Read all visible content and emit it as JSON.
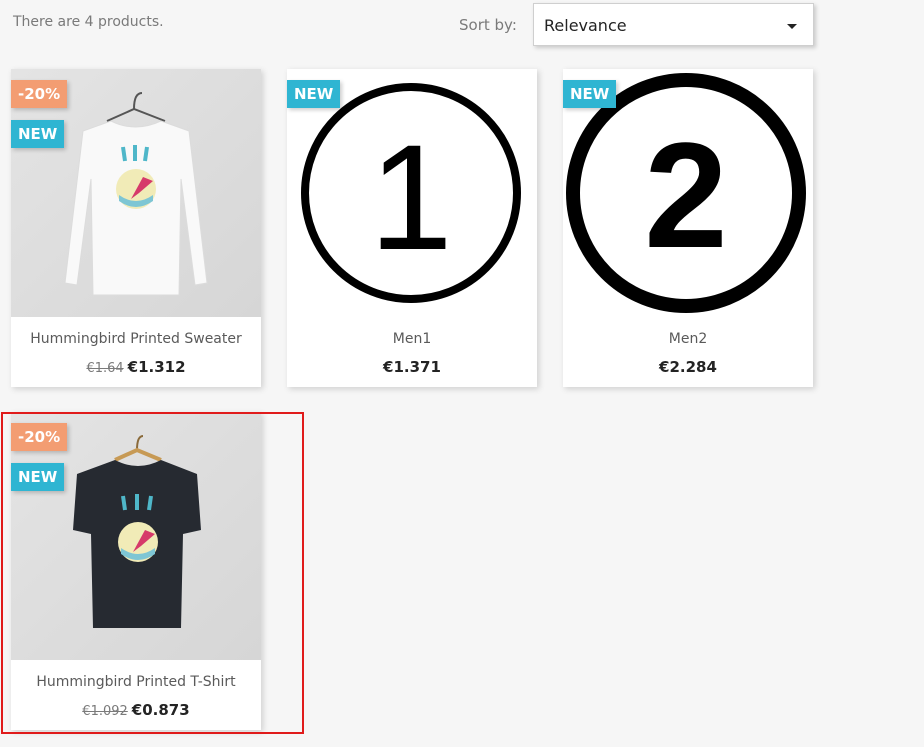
{
  "listing": {
    "count_text": "There are 4 products.",
    "sort_label": "Sort by:",
    "sort_value": "Relevance"
  },
  "products": [
    {
      "name": "Hummingbird Printed Sweater",
      "old_price": "€1.64",
      "price": "€1.312",
      "discount_flag": "-20%",
      "new_flag": "NEW"
    },
    {
      "name": "Men1",
      "old_price": "",
      "price": "€1.371",
      "discount_flag": "",
      "new_flag": "NEW"
    },
    {
      "name": "Men2",
      "old_price": "",
      "price": "€2.284",
      "discount_flag": "",
      "new_flag": "NEW"
    },
    {
      "name": "Hummingbird Printed T-Shirt",
      "old_price": "€1.092",
      "price": "€0.873",
      "discount_flag": "-20%",
      "new_flag": "NEW"
    }
  ],
  "thumbnails": {
    "men1_digit": "1",
    "men2_digit": "2"
  },
  "colors": {
    "new_flag": "#2fb5d2",
    "discount_flag": "#f39d72",
    "selection_outline": "#e01b1b"
  }
}
